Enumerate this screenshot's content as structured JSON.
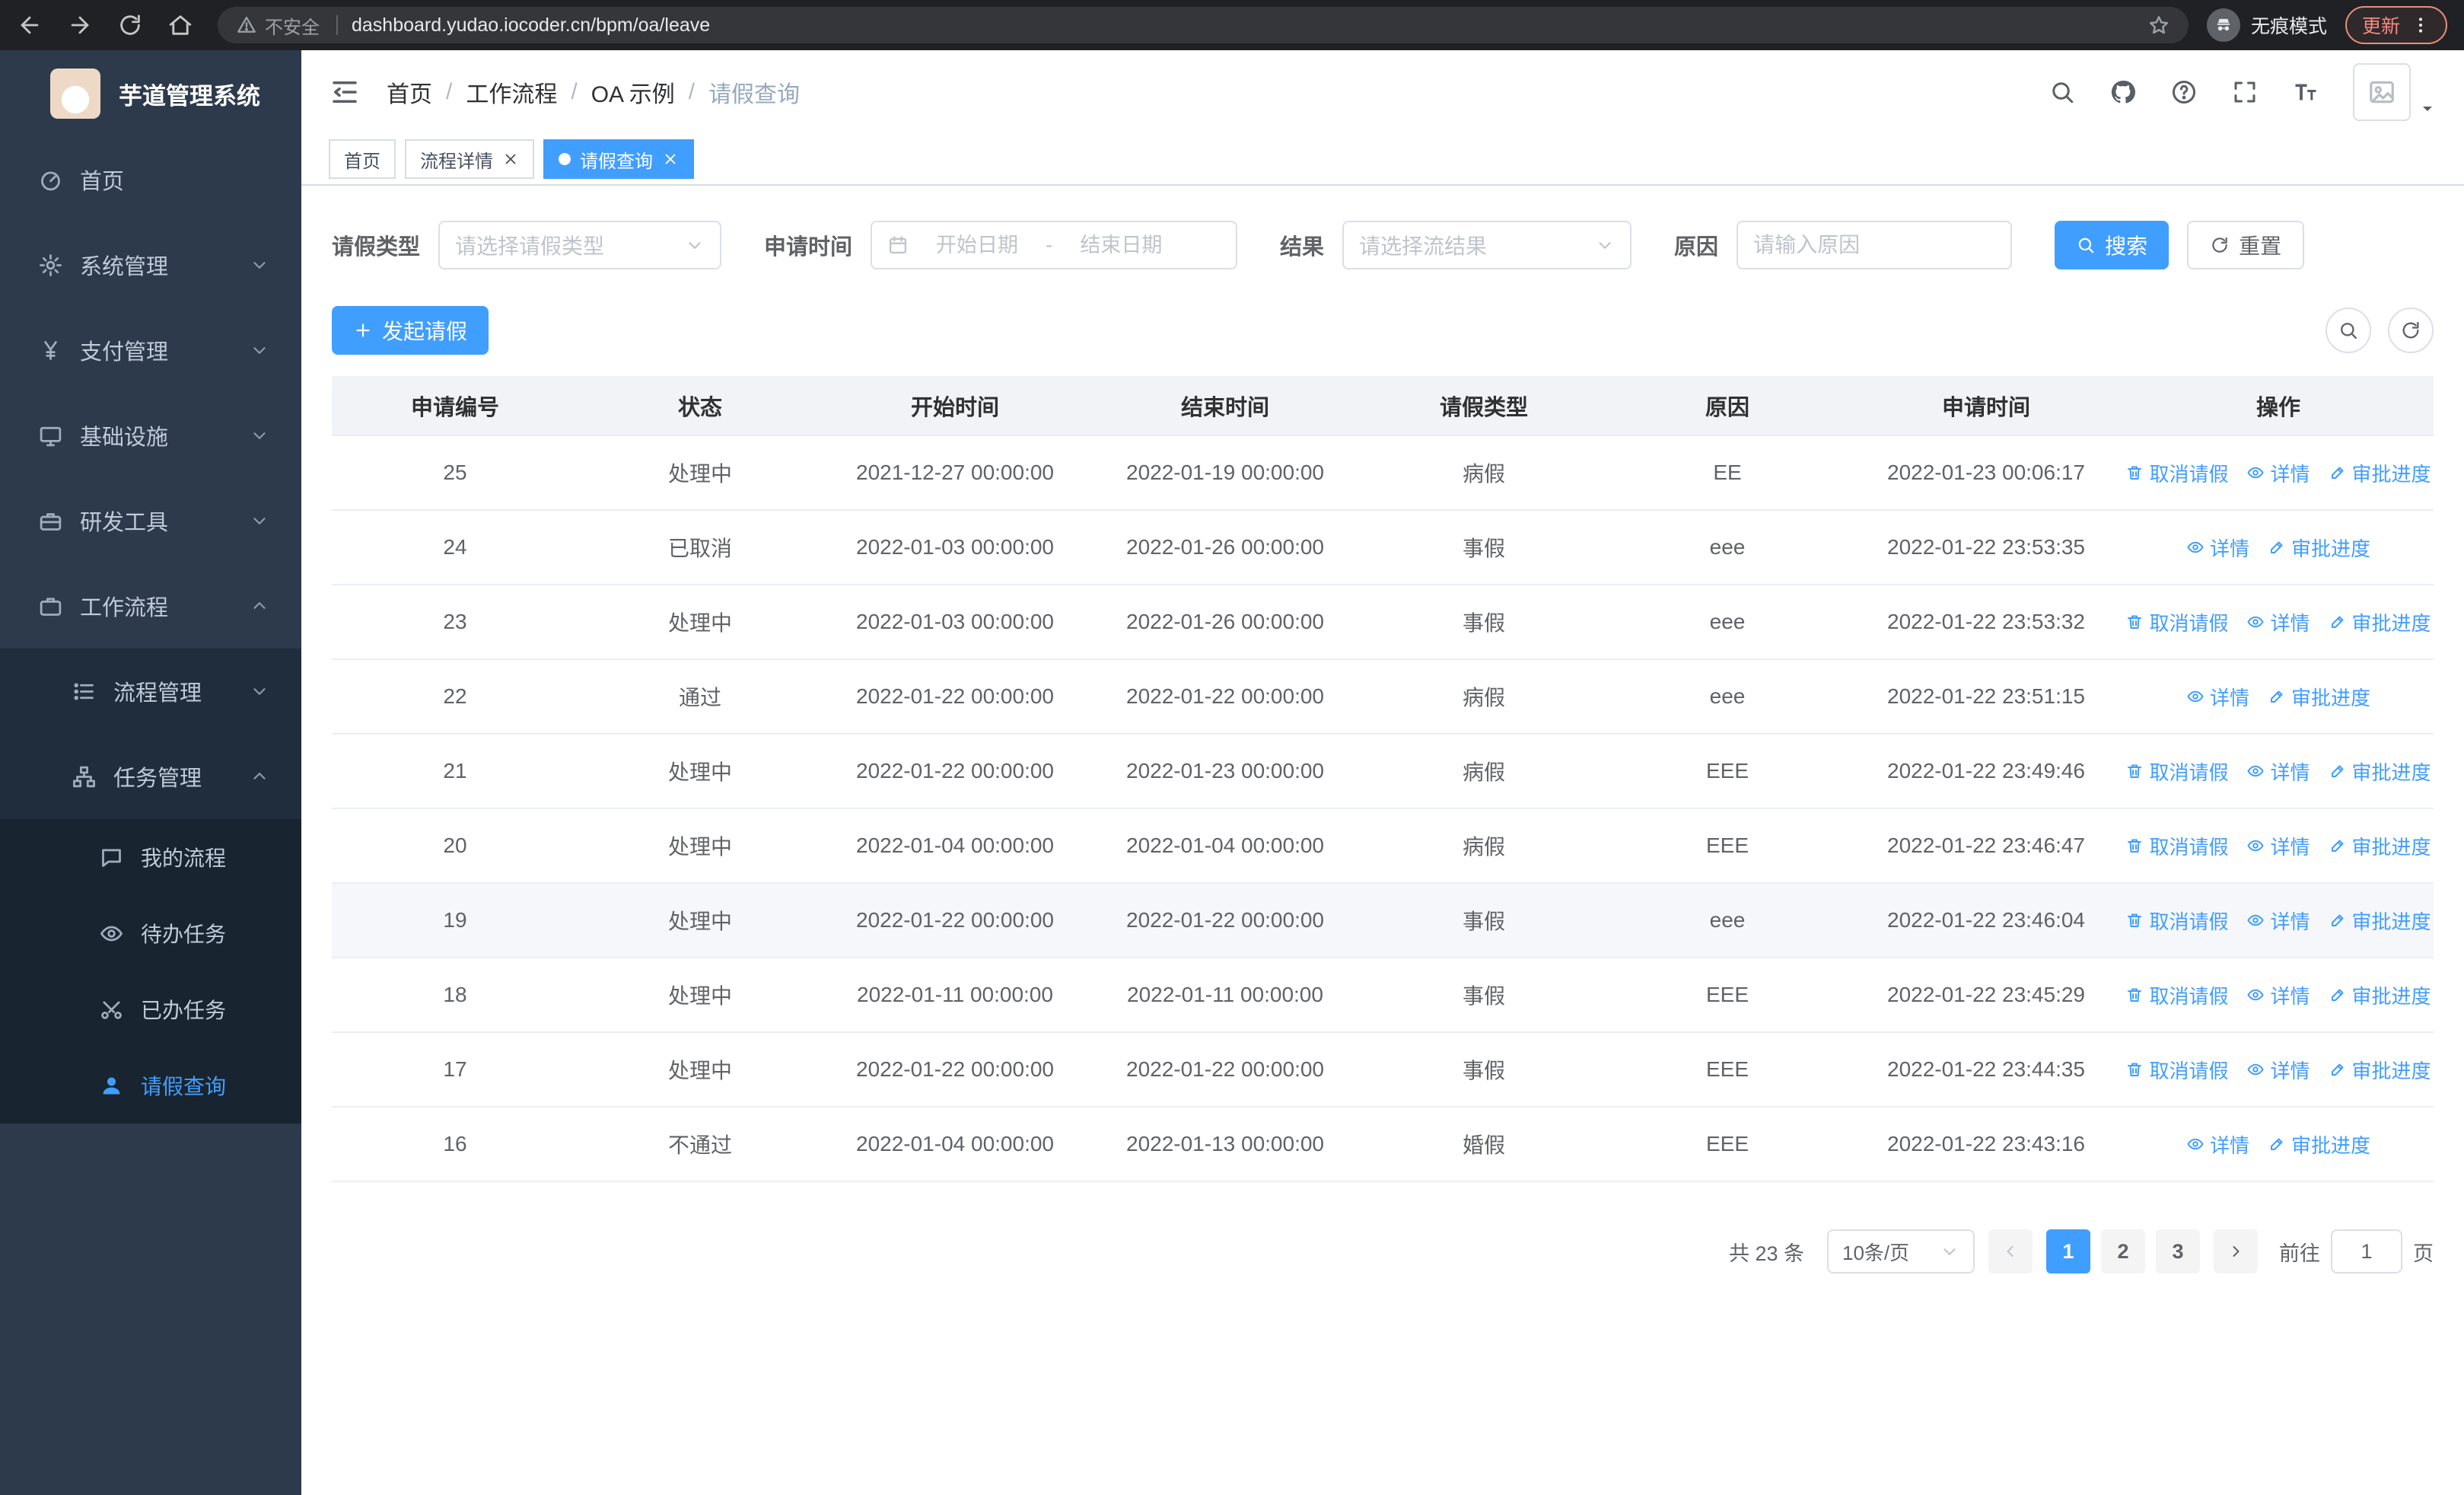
{
  "browser": {
    "security_warning": "不安全",
    "url": "dashboard.yudao.iocoder.cn/bpm/oa/leave",
    "incognito_label": "无痕模式",
    "update_label": "更新"
  },
  "sidebar": {
    "logo_title": "芋道管理系统",
    "menu": [
      {
        "label": "首页",
        "icon": "dashboard-icon",
        "level": 1
      },
      {
        "label": "系统管理",
        "icon": "gear-icon",
        "level": 1,
        "arrow": "down"
      },
      {
        "label": "支付管理",
        "icon": "yen-icon",
        "level": 1,
        "arrow": "down"
      },
      {
        "label": "基础设施",
        "icon": "monitor-icon",
        "level": 1,
        "arrow": "down"
      },
      {
        "label": "研发工具",
        "icon": "toolbox-icon",
        "level": 1,
        "arrow": "down"
      },
      {
        "label": "工作流程",
        "icon": "briefcase-icon",
        "level": 1,
        "arrow": "up"
      },
      {
        "label": "流程管理",
        "icon": "list-icon",
        "level": 2,
        "arrow": "down"
      },
      {
        "label": "任务管理",
        "icon": "tree-icon",
        "level": 2,
        "arrow": "up"
      },
      {
        "label": "我的流程",
        "icon": "chat-icon",
        "level": 3
      },
      {
        "label": "待办任务",
        "icon": "eye-icon",
        "level": 3
      },
      {
        "label": "已办任务",
        "icon": "done-icon",
        "level": 3
      },
      {
        "label": "请假查询",
        "icon": "user-icon",
        "level": 3,
        "active": true
      }
    ]
  },
  "header": {
    "breadcrumb": [
      "首页",
      "工作流程",
      "OA 示例",
      "请假查询"
    ],
    "breadcrumb_separator": "/"
  },
  "tabs": [
    {
      "label": "首页",
      "closable": false,
      "active": false
    },
    {
      "label": "流程详情",
      "closable": true,
      "active": false
    },
    {
      "label": "请假查询",
      "closable": true,
      "active": true
    }
  ],
  "filters": {
    "leave_type_label": "请假类型",
    "leave_type_placeholder": "请选择请假类型",
    "apply_time_label": "申请时间",
    "start_date_placeholder": "开始日期",
    "range_separator": "-",
    "end_date_placeholder": "结束日期",
    "result_label": "结果",
    "result_placeholder": "请选择流结果",
    "reason_label": "原因",
    "reason_placeholder": "请输入原因",
    "search_label": "搜索",
    "reset_label": "重置"
  },
  "toolbar": {
    "create_label": "发起请假"
  },
  "table": {
    "columns": [
      "申请编号",
      "状态",
      "开始时间",
      "结束时间",
      "请假类型",
      "原因",
      "申请时间",
      "操作"
    ],
    "action_labels": {
      "cancel": "取消请假",
      "detail": "详情",
      "progress": "审批进度"
    },
    "rows": [
      {
        "id": "25",
        "status": "处理中",
        "start": "2021-12-27 00:00:00",
        "end": "2022-01-19 00:00:00",
        "type": "病假",
        "reason": "EE",
        "applied": "2022-01-23 00:06:17",
        "actions": [
          "cancel",
          "detail",
          "progress"
        ],
        "highlight": false
      },
      {
        "id": "24",
        "status": "已取消",
        "start": "2022-01-03 00:00:00",
        "end": "2022-01-26 00:00:00",
        "type": "事假",
        "reason": "eee",
        "applied": "2022-01-22 23:53:35",
        "actions": [
          "detail",
          "progress"
        ],
        "highlight": false
      },
      {
        "id": "23",
        "status": "处理中",
        "start": "2022-01-03 00:00:00",
        "end": "2022-01-26 00:00:00",
        "type": "事假",
        "reason": "eee",
        "applied": "2022-01-22 23:53:32",
        "actions": [
          "cancel",
          "detail",
          "progress"
        ],
        "highlight": false
      },
      {
        "id": "22",
        "status": "通过",
        "start": "2022-01-22 00:00:00",
        "end": "2022-01-22 00:00:00",
        "type": "病假",
        "reason": "eee",
        "applied": "2022-01-22 23:51:15",
        "actions": [
          "detail",
          "progress"
        ],
        "highlight": false
      },
      {
        "id": "21",
        "status": "处理中",
        "start": "2022-01-22 00:00:00",
        "end": "2022-01-23 00:00:00",
        "type": "病假",
        "reason": "EEE",
        "applied": "2022-01-22 23:49:46",
        "actions": [
          "cancel",
          "detail",
          "progress"
        ],
        "highlight": false
      },
      {
        "id": "20",
        "status": "处理中",
        "start": "2022-01-04 00:00:00",
        "end": "2022-01-04 00:00:00",
        "type": "病假",
        "reason": "EEE",
        "applied": "2022-01-22 23:46:47",
        "actions": [
          "cancel",
          "detail",
          "progress"
        ],
        "highlight": false
      },
      {
        "id": "19",
        "status": "处理中",
        "start": "2022-01-22 00:00:00",
        "end": "2022-01-22 00:00:00",
        "type": "事假",
        "reason": "eee",
        "applied": "2022-01-22 23:46:04",
        "actions": [
          "cancel",
          "detail",
          "progress"
        ],
        "highlight": true
      },
      {
        "id": "18",
        "status": "处理中",
        "start": "2022-01-11 00:00:00",
        "end": "2022-01-11 00:00:00",
        "type": "事假",
        "reason": "EEE",
        "applied": "2022-01-22 23:45:29",
        "actions": [
          "cancel",
          "detail",
          "progress"
        ],
        "highlight": false
      },
      {
        "id": "17",
        "status": "处理中",
        "start": "2022-01-22 00:00:00",
        "end": "2022-01-22 00:00:00",
        "type": "事假",
        "reason": "EEE",
        "applied": "2022-01-22 23:44:35",
        "actions": [
          "cancel",
          "detail",
          "progress"
        ],
        "highlight": false
      },
      {
        "id": "16",
        "status": "不通过",
        "start": "2022-01-04 00:00:00",
        "end": "2022-01-13 00:00:00",
        "type": "婚假",
        "reason": "EEE",
        "applied": "2022-01-22 23:43:16",
        "actions": [
          "detail",
          "progress"
        ],
        "highlight": false
      }
    ]
  },
  "pagination": {
    "total_text": "共 23 条",
    "page_size": "10条/页",
    "pages": [
      "1",
      "2",
      "3"
    ],
    "active_page": "1",
    "goto_label": "前往",
    "goto_value": "1",
    "goto_suffix": "页"
  },
  "colors": {
    "primary": "#409eff",
    "sidebar_bg": "#2d3a4b",
    "submenu_bg": "#1f2d3d"
  }
}
